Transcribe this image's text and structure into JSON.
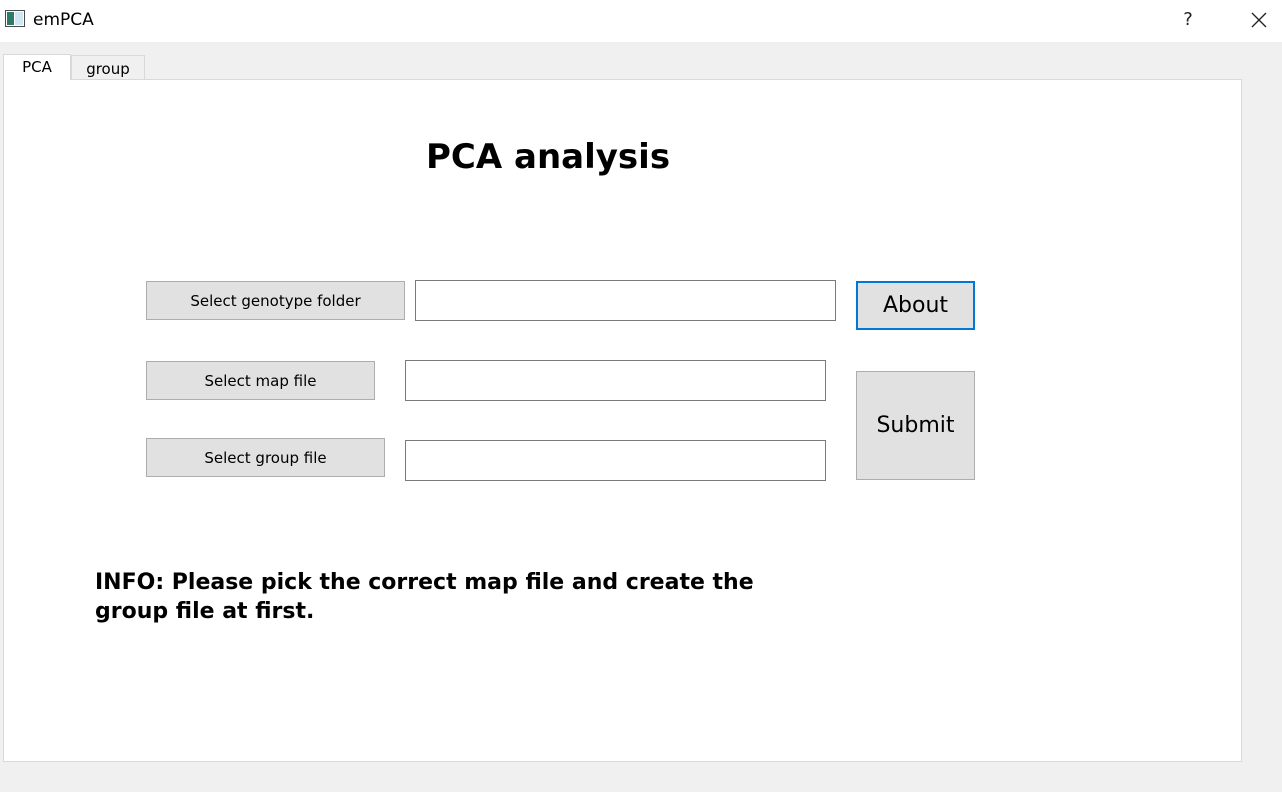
{
  "window": {
    "title": "emPCA",
    "help_label": "?"
  },
  "tabs": [
    {
      "label": "PCA",
      "active": true
    },
    {
      "label": "group",
      "active": false
    }
  ],
  "main": {
    "title": "PCA analysis",
    "genotype_button_label": "Select genotype folder",
    "genotype_path": "",
    "map_button_label": "Select map file",
    "map_path": "",
    "group_button_label": "Select group file",
    "group_path": "",
    "about_label": "About",
    "submit_label": "Submit",
    "info": "INFO: Please pick the correct map file and create the group file at first."
  },
  "colors": {
    "focus_border": "#0078d7",
    "button_face": "#e1e1e1",
    "background": "#f0f0f0"
  }
}
